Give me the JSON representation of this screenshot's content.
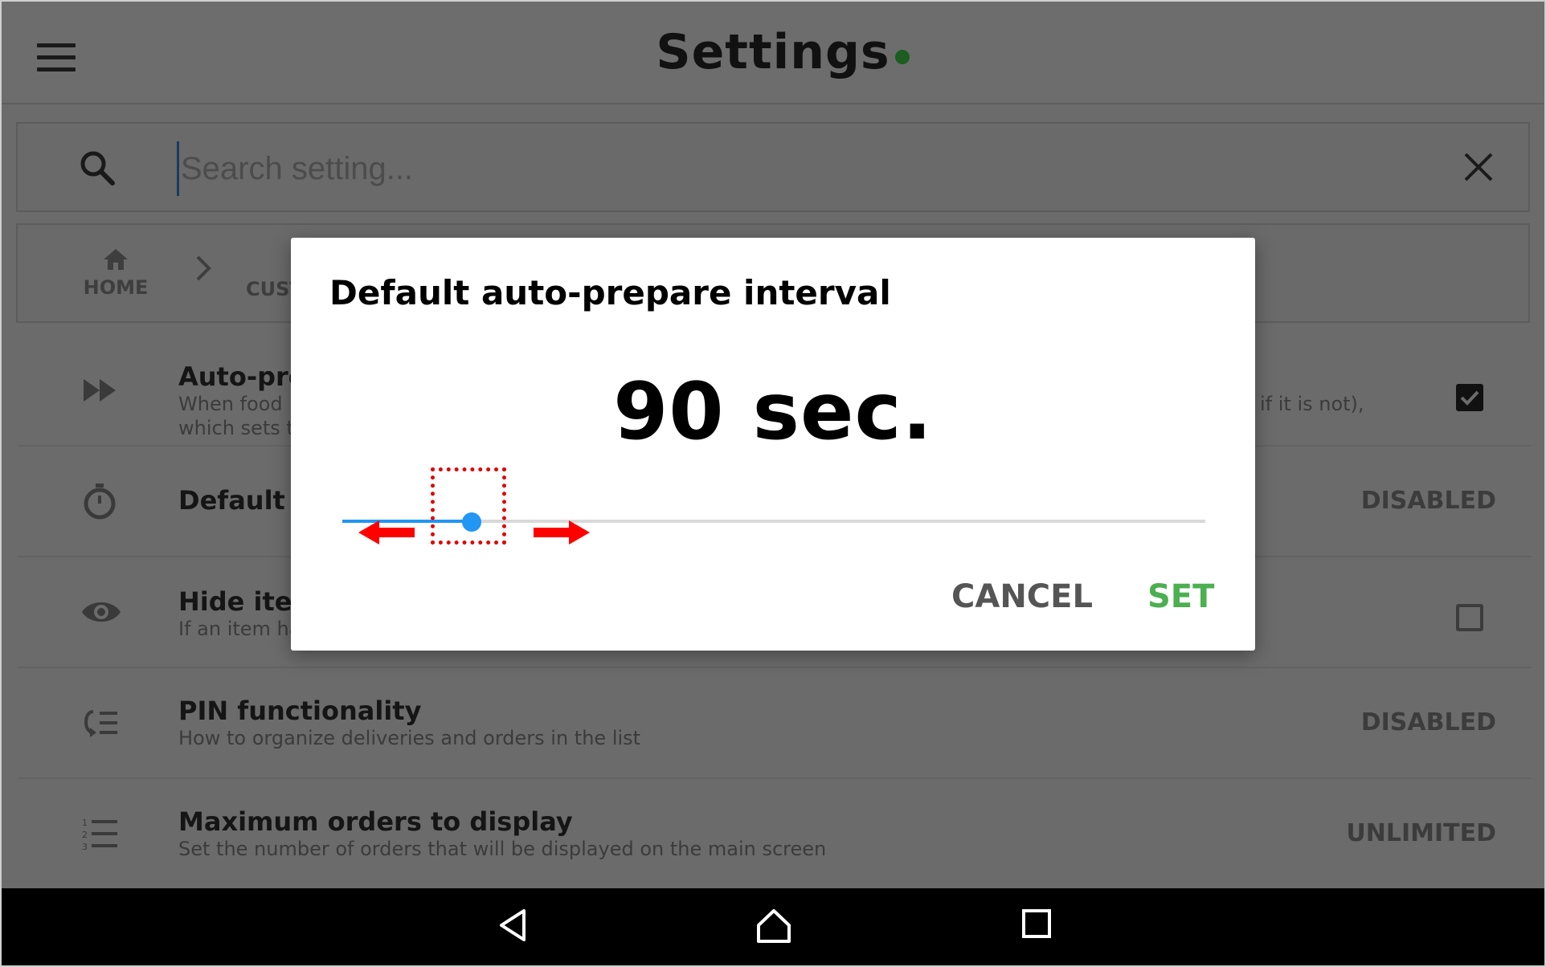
{
  "app_bar": {
    "title": "Settings",
    "status_color": "#1b5e20",
    "menu_icon": "menu-icon"
  },
  "search": {
    "placeholder": "Search setting...",
    "value": "",
    "search_icon": "search-icon",
    "clear_icon": "close-icon"
  },
  "breadcrumb": {
    "home_label": "HOME",
    "current_label": "CUST"
  },
  "settings": [
    {
      "icon": "fast-forward-icon",
      "title": "Auto-pre",
      "subtitle_line1": "When food",
      "subtitle_line1_right": "if it is not),",
      "subtitle_line2": "which sets t",
      "control": "checkbox",
      "checked": true
    },
    {
      "icon": "timer-icon",
      "title": "Default a",
      "subtitle_line1": "",
      "subtitle_line2": "",
      "control": "value",
      "value": "DISABLED"
    },
    {
      "icon": "eye-icon",
      "title": "Hide iter",
      "subtitle_line1": "If an item ha",
      "subtitle_line2": "",
      "control": "checkbox",
      "checked": false
    },
    {
      "icon": "pin-list-icon",
      "title": "PIN functionality",
      "subtitle_line1": "How to organize deliveries and orders in the list",
      "subtitle_line2": "",
      "control": "value",
      "value": "DISABLED"
    },
    {
      "icon": "numbered-list-icon",
      "title": "Maximum orders to display",
      "subtitle_line1": "Set the number of orders that will be displayed on the main screen",
      "subtitle_line2": "",
      "control": "value",
      "value": "UNLIMITED"
    }
  ],
  "dialog": {
    "title": "Default auto-prepare interval",
    "value_text": "90 sec.",
    "slider_fraction": 0.15,
    "slider_color": "#2196f3",
    "cancel_label": "CANCEL",
    "set_label": "SET",
    "set_color": "#4caf50"
  },
  "nav_bar": {
    "back_icon": "back-icon",
    "home_icon": "home-icon",
    "recents_icon": "recents-icon"
  }
}
